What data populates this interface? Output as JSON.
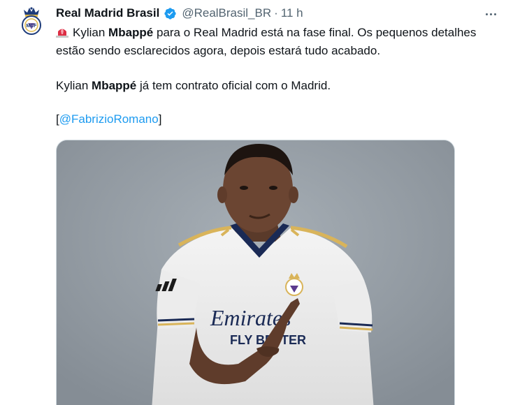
{
  "account": {
    "display_name": "Real Madrid Brasil",
    "handle": "@RealBrasil_BR",
    "separator": "·",
    "time": "11 h",
    "avatar_icon": "real-madrid-crest-icon",
    "verified_icon": "verified-badge-icon",
    "verified_color": "#1d9bf0"
  },
  "tweet": {
    "siren_icon": "police-siren-emoji",
    "p1_a": "Kylian ",
    "p1_b": "Mbappé",
    "p1_c": " para o Real Madrid está na fase final. Os pequenos detalhes estão sendo esclarecidos agora, depois estará tudo acabado.",
    "p2_a": "Kylian ",
    "p2_b": "Mbappé",
    "p2_c": " já tem contrato oficial com o Madrid.",
    "p3_open": "[",
    "p3_mention": "@FabrizioRomano",
    "p3_close": "]",
    "link_color": "#1d9bf0"
  },
  "media": {
    "jersey_text_top": "Emirates",
    "jersey_text_bottom": "FLY BETTER"
  },
  "colors": {
    "text": "#0f1419",
    "secondary": "#536471",
    "border": "#cfd9de"
  }
}
